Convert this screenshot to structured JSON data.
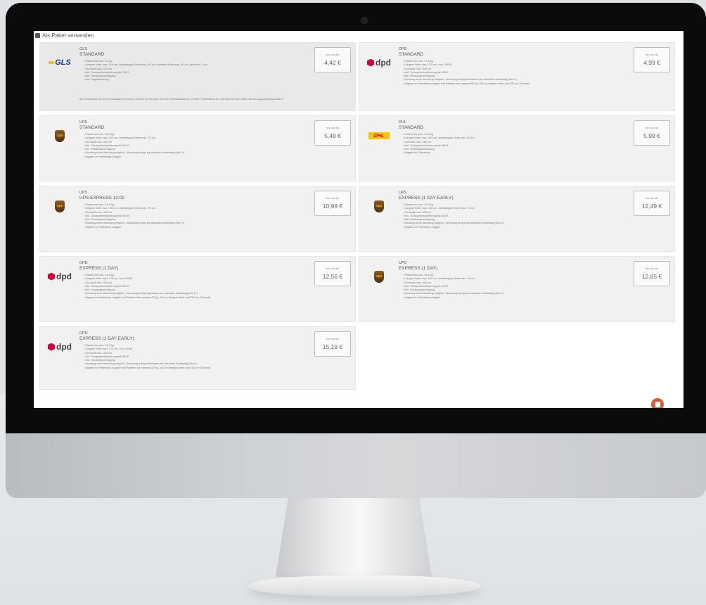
{
  "page": {
    "heading": "Als Paket versenden"
  },
  "labels": {
    "price_caption": "bei uns für"
  },
  "cards": [
    {
      "carrier": "GLS",
      "service": "STANDARD",
      "price": "4,42 €",
      "logo": "gls-logo",
      "features": [
        "Pakete bis max. 40 kg",
        "Längste Seite max. 120 cm, zweitlängste Seite max. 80 cm, kürzeste Seite max. 60 cm, aber min. 3 cm",
        "Gurtmaß max. 300 cm",
        "inkl. Transportversicherung bis 750 €",
        "inkl. Sendungsverfolgung",
        "inkl. Regelabholung"
      ],
      "note": "Bei mindestens 20 GLS-Sendungen im Monat, melden wir Sie gern mit Ihrer Versandadresse für Ihren Paketdienst an. Wenden Sie sich dafür bitte an support@shipcloud.io"
    },
    {
      "carrier": "DPD",
      "service": "STANDARD",
      "price": "4,99 €",
      "logo": "dpd-logo",
      "features": [
        "Pakete bis max. 31,5 kg",
        "Längste Seite max. 175 cm, min. 0/9/45",
        "Gurtmaß max. 300 cm",
        "inkl. Transportversicherung bis 520 €",
        "inkl. Sendungsverfolgung",
        "Buchung einer Abholung möglich - Abholung erfolgt frühestens am nächsten Arbeitstag (Mo-Fr)",
        "Abgabe im Paketshop möglich bei Paketen bis maximal 20 kg, 100 cm längste Seite und 250 cm Gurtmaß"
      ]
    },
    {
      "carrier": "UPS",
      "service": "STANDARD",
      "price": "5,49 €",
      "logo": "ups-logo",
      "features": [
        "Pakete bis max. 31,5 kg",
        "Längste Seite max. 100 cm, zweitlängste Seite max. 76 cm",
        "Gurtmaß max. 300 cm",
        "inkl. Transportversicherung bis 510 €",
        "inkl. Sendungsverfolgung",
        "Buchung einer Abholung möglich - Abholung erfolgt am nächsten Arbeitstag (Mo-Fr)",
        "Abgabe im Paketshop möglich"
      ]
    },
    {
      "carrier": "DHL",
      "service": "STANDARD",
      "price": "5,99 €",
      "logo": "dhl-logo",
      "features": [
        "Pakete bis max. 31,5 kg",
        "Längste Seite max. 120 cm, zweitlängste Seite max. 60 cm",
        "Gurtmaß max. 360 cm",
        "inkl. Transportversicherung bis 500 €",
        "inkl. Sendungsverfolgung",
        "Abgabe im Paketshop"
      ]
    },
    {
      "carrier": "UPS",
      "service": "UPS EXPRESS 12:00",
      "price": "10,99 €",
      "logo": "ups-logo",
      "features": [
        "Pakete bis max. 31,5 kg",
        "Längste Seite max. 100 cm, zweitlängste Seite max. 76 cm",
        "Gurtmaß max. 300 cm",
        "inkl. Transportversicherung bis 510 €",
        "inkl. Sendungsverfolgung",
        "Buchung einer Abholung möglich - Abholung erfolgt am nächsten Arbeitstag (Mo-Fr)",
        "Abgabe im Paketshop möglich"
      ]
    },
    {
      "carrier": "UPS",
      "service": "EXPRESS (1 DAY EARLY)",
      "price": "12,49 €",
      "logo": "ups-logo",
      "features": [
        "Pakete bis max. 31,5 kg",
        "Längste Seite max. 100 cm, zweitlängste Seite max. 76 cm",
        "Gurtmaß max. 300 cm",
        "inkl. Transportversicherung bis 510 €",
        "inkl. Sendungsverfolgung",
        "Buchung einer Abholung möglich - Abholung erfolgt am nächsten Arbeitstag (Mo-Fr)",
        "Abgabe im Paketshop möglich"
      ]
    },
    {
      "carrier": "DPD",
      "service": "EXPRESS (1 DAY)",
      "price": "12,56 €",
      "logo": "dpd-logo",
      "features": [
        "Pakete bis max. 31,5 kg",
        "Längste Seite max. 175 cm, min. 0/9/45",
        "Gurtmaß max. 300 cm",
        "inkl. Transportversicherung bis 520 €",
        "inkl. Sendungsverfolgung",
        "Buchung einer Abholung möglich - Abholung erfolgt frühestens am nächsten Arbeitstag (Mo-Fr)",
        "Abgabe im Paketshop möglich bei Paketen bis maximal 20 kg, 100 cm längste Seite und 250 cm Gurtmaß"
      ]
    },
    {
      "carrier": "UPS",
      "service": "EXPRESS (1 DAY)",
      "price": "12,65 €",
      "logo": "ups-logo",
      "features": [
        "Pakete bis max. 31,5 kg",
        "Längste Seite max. 100 cm, zweitlängste Seite max. 76 cm",
        "Gurtmaß max. 300 cm",
        "inkl. Transportversicherung bis 510 €",
        "inkl. Sendungsverfolgung",
        "Buchung einer Abholung möglich - Abholung erfolgt am nächsten Arbeitstag (Mo-Fr)",
        "Abgabe im Paketshop möglich"
      ]
    },
    {
      "carrier": "DPD",
      "service": "EXPRESS (1 DAY EARLY)",
      "price": "15,19 €",
      "logo": "dpd-logo",
      "features": [
        "Pakete bis max. 31,5 kg",
        "Längste Seite max. 175 cm, min. 0/9/45",
        "Gurtmaß max. 300 cm",
        "inkl. Transportversicherung bis 520 €",
        "inkl. Sendungsverfolgung",
        "Buchung einer Abholung möglich - Abholung erfolgt frühestens am nächsten Arbeitstag (Mo-Fr)",
        "Abgabe im Paketshop möglich bei Paketen bis maximal 20 kg, 100 cm längste Seite und 250 cm Gurtmaß"
      ]
    }
  ],
  "brand_text": {
    "gls": "GLS",
    "dpd": "dpd",
    "ups": "ups",
    "dhl": "DHL"
  },
  "colors": {
    "dpd_red": "#d3003a",
    "ups_brown": "#5c3a13",
    "dhl_yellow": "#f7c600",
    "gls_blue": "#0a3a8c",
    "chat_button": "#e05a2b"
  },
  "icons": [
    "package-icon",
    "chat-icon"
  ]
}
